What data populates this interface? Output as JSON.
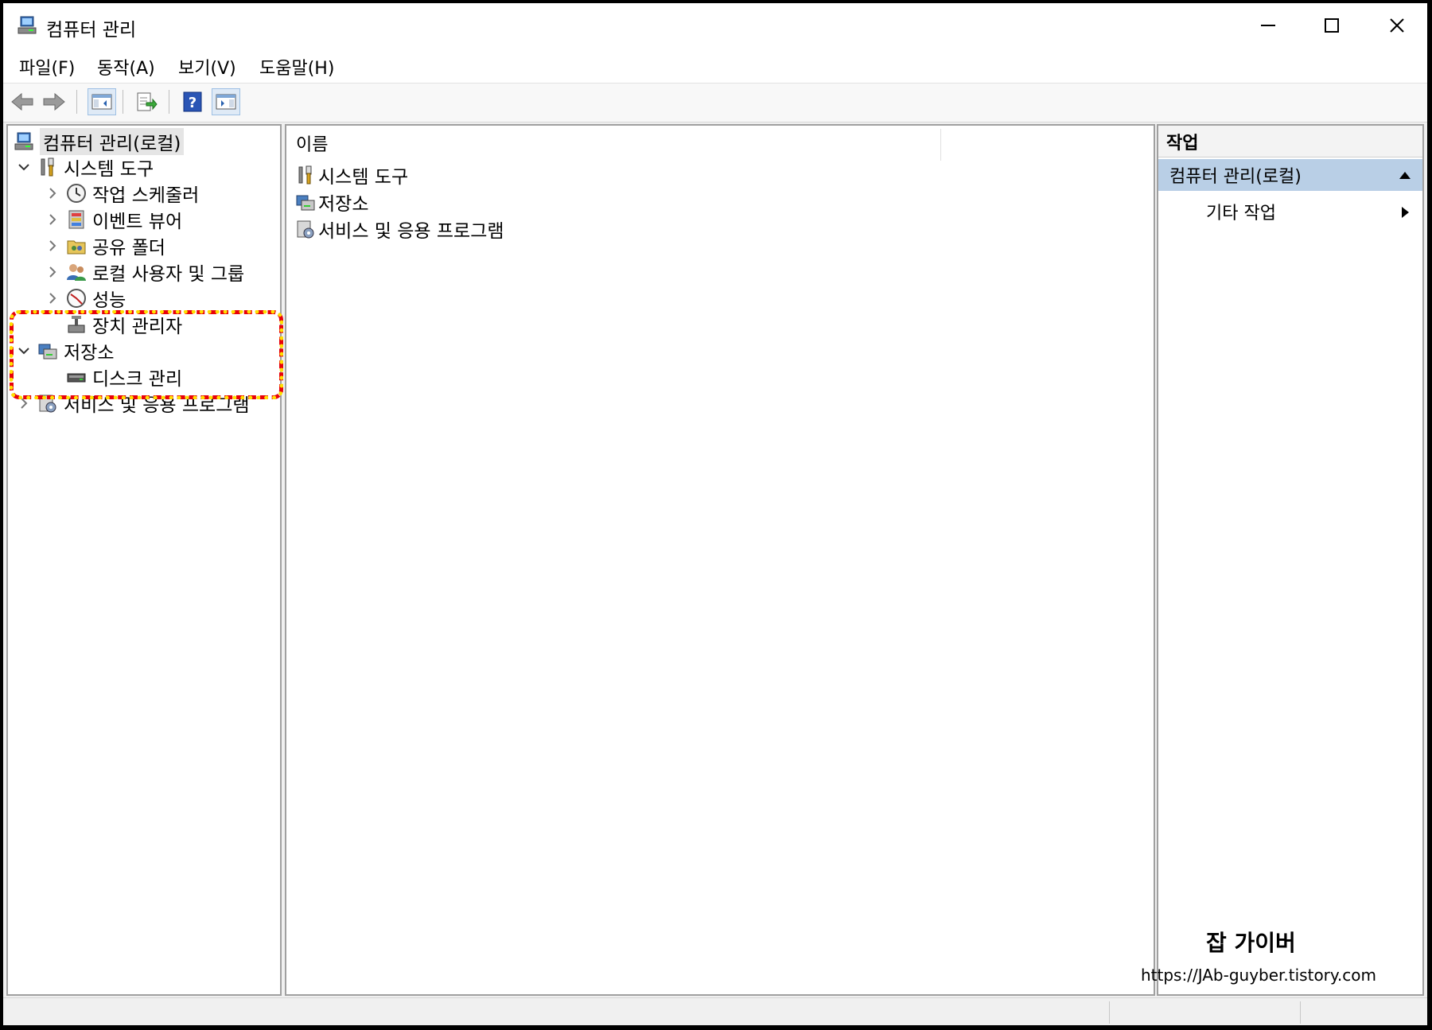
{
  "window": {
    "title": "컴퓨터 관리"
  },
  "menu": {
    "file": "파일(F)",
    "action": "동작(A)",
    "view": "보기(V)",
    "help": "도움말(H)"
  },
  "toolbar": {
    "icons": [
      "back-icon",
      "forward-icon",
      "show-hide-tree-icon",
      "export-list-icon",
      "help-icon",
      "show-hide-action-pane-icon"
    ]
  },
  "tree": {
    "root": "컴퓨터 관리(로컬)",
    "system_tools": "시스템 도구",
    "task_scheduler": "작업 스케줄러",
    "event_viewer": "이벤트 뷰어",
    "shared_folders": "공유 폴더",
    "local_users": "로컬 사용자 및 그룹",
    "performance": "성능",
    "device_manager": "장치 관리자",
    "storage": "저장소",
    "disk_management": "디스크 관리",
    "services_apps": "서비스 및 응용 프로그램"
  },
  "list": {
    "column_name": "이름",
    "items": [
      "시스템 도구",
      "저장소",
      "서비스 및 응용 프로그램"
    ]
  },
  "actions": {
    "header": "작업",
    "section": "컴퓨터 관리(로컬)",
    "more": "기타 작업"
  },
  "watermark": {
    "title": "잡 가이버",
    "url": "https://JAb-guyber.tistory.com"
  },
  "colors": {
    "highlight_outer": "#e8000b",
    "highlight_inner": "#ffe000",
    "action_section_bg": "#b9cfe6"
  }
}
